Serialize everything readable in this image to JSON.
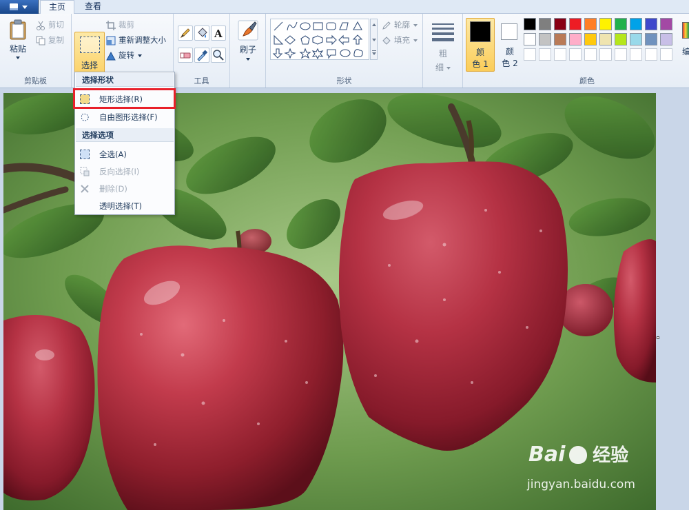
{
  "tabs": {
    "home": "主页",
    "view": "查看"
  },
  "clipboard": {
    "paste": "粘贴",
    "cut": "剪切",
    "copy": "复制",
    "group_label": "剪贴板"
  },
  "image": {
    "select": "选择",
    "crop": "裁剪",
    "resize": "重新调整大小",
    "rotate": "旋转"
  },
  "tools": {
    "group_label": "工具"
  },
  "brushes": {
    "label": "刷子"
  },
  "shapes": {
    "outline": "轮廓",
    "fill": "填充",
    "group_label": "形状"
  },
  "size": {
    "label_line1": "粗",
    "label_line2": "细"
  },
  "colors": {
    "color1_line1": "颜",
    "color1_line2": "色 1",
    "color2_line1": "颜",
    "color2_line2": "色 2",
    "group_label": "颜色",
    "edit_label": "编辑",
    "color1_value": "#000000",
    "color2_value": "#ffffff",
    "palette_row1": [
      "#000000",
      "#7f7f7f",
      "#880015",
      "#ed1c24",
      "#ff7f27",
      "#fff200",
      "#22b14c",
      "#00a2e8",
      "#3f48cc",
      "#a349a4"
    ],
    "palette_row2": [
      "#ffffff",
      "#c3c3c3",
      "#b97a57",
      "#ffaec9",
      "#ffc90e",
      "#efe4b0",
      "#b5e61d",
      "#99d9ea",
      "#7092be",
      "#c8bfe7"
    ]
  },
  "menu": {
    "header_shape": "选择形状",
    "rect_select": "矩形选择(R)",
    "free_select": "自由图形选择(F)",
    "header_options": "选择选项",
    "select_all": "全选(A)",
    "invert": "反向选择(I)",
    "delete": "删除(D)",
    "transparent": "透明选择(T)"
  },
  "watermark": {
    "brand": "Bai",
    "brand_cn": "经验",
    "url": "jingyan.baidu.com"
  }
}
